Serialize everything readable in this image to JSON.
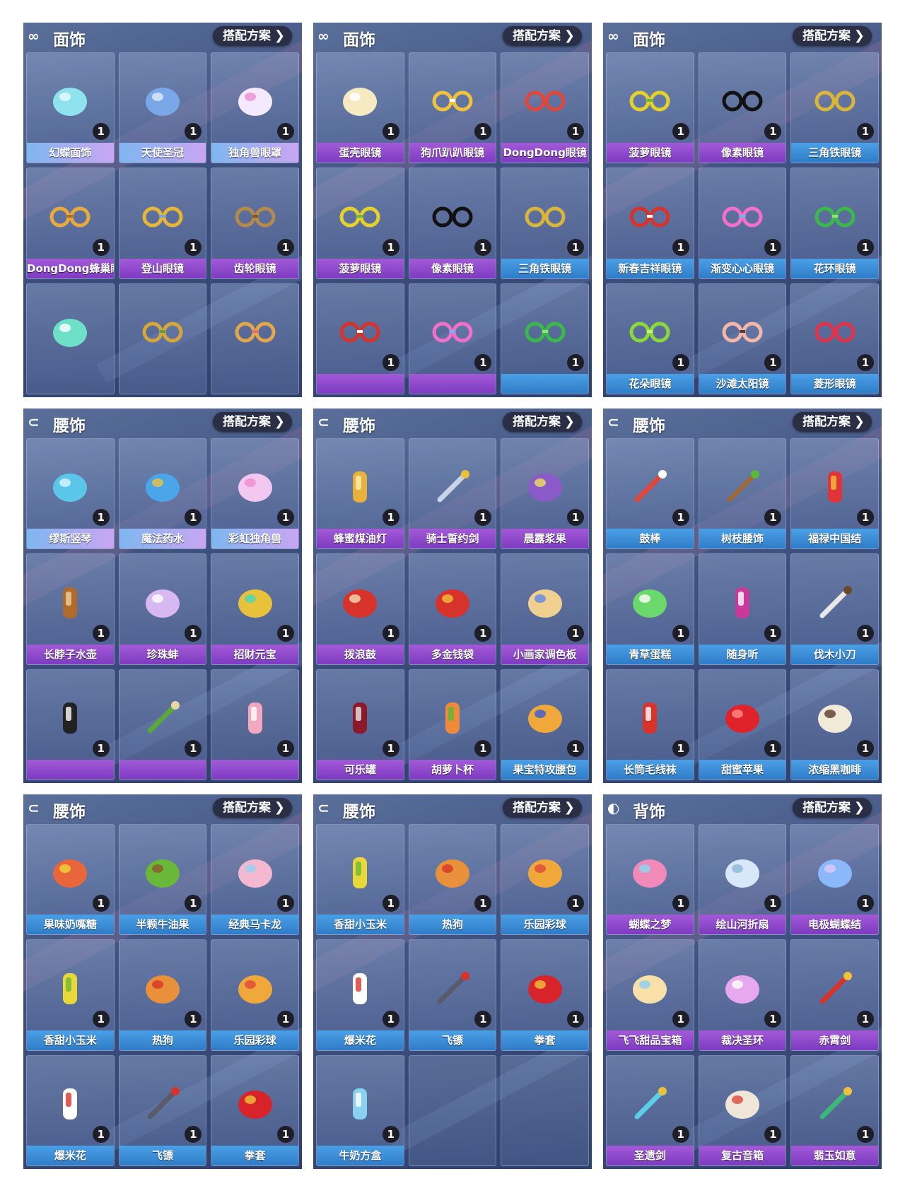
{
  "colors": {
    "purple_label": "#8a45cc",
    "blue_label": "#3a8ad8",
    "pastel_label": "#a9b0f2",
    "badge": "#1e1e28"
  },
  "panels": [
    {
      "category": "面饰",
      "icon": "glasses-icon",
      "plan_label": "搭配方案",
      "items": [
        {
          "name": "幻蝶面饰",
          "count": "1",
          "label_style": "pastel",
          "icon": "butterfly-mask-icon"
        },
        {
          "name": "天使圣冠",
          "count": "1",
          "label_style": "pastel",
          "icon": "halo-crown-icon"
        },
        {
          "name": "独角兽眼罩",
          "count": "1",
          "label_style": "pastel",
          "icon": "unicorn-mask-icon"
        },
        {
          "name": "DongDong蜂巢眼镜",
          "count": "1",
          "label_style": "purple",
          "icon": "hexagon-glasses-icon"
        },
        {
          "name": "登山眼镜",
          "count": "1",
          "label_style": "purple",
          "icon": "goggles-icon"
        },
        {
          "name": "齿轮眼镜",
          "count": "1",
          "label_style": "purple",
          "icon": "gear-glasses-icon"
        },
        {
          "name": "",
          "count": "",
          "label_style": "none",
          "icon": "fox-mask-icon"
        },
        {
          "name": "",
          "count": "",
          "label_style": "none",
          "icon": "leaf-glasses-icon"
        },
        {
          "name": "",
          "count": "",
          "label_style": "none",
          "icon": "waffle-glasses-icon"
        }
      ]
    },
    {
      "category": "面饰",
      "icon": "glasses-icon",
      "plan_label": "搭配方案",
      "items": [
        {
          "name": "蛋壳眼镜",
          "count": "1",
          "label_style": "purple",
          "icon": "eggshell-glasses-icon"
        },
        {
          "name": "狗爪趴趴眼镜",
          "count": "1",
          "label_style": "purple",
          "icon": "paw-glasses-icon"
        },
        {
          "name": "DongDong眼镜",
          "count": "1",
          "label_style": "purple",
          "icon": "round-glasses-icon"
        },
        {
          "name": "菠萝眼镜",
          "count": "1",
          "label_style": "purple",
          "icon": "pineapple-glasses-icon"
        },
        {
          "name": "像素眼镜",
          "count": "1",
          "label_style": "purple",
          "icon": "pixel-glasses-icon"
        },
        {
          "name": "三角铁眼镜",
          "count": "1",
          "label_style": "blue",
          "icon": "triangle-glasses-icon"
        },
        {
          "name": "",
          "count": "1",
          "label_style": "purple",
          "icon": "red-white-glasses-icon"
        },
        {
          "name": "",
          "count": "1",
          "label_style": "purple",
          "icon": "heart-glasses-icon"
        },
        {
          "name": "",
          "count": "1",
          "label_style": "blue",
          "icon": "flower-ring-glasses-icon"
        }
      ]
    },
    {
      "category": "面饰",
      "icon": "glasses-icon",
      "plan_label": "搭配方案",
      "items": [
        {
          "name": "菠萝眼镜",
          "count": "1",
          "label_style": "purple",
          "icon": "pineapple-glasses-icon"
        },
        {
          "name": "像素眼镜",
          "count": "1",
          "label_style": "purple",
          "icon": "pixel-glasses-icon"
        },
        {
          "name": "三角铁眼镜",
          "count": "1",
          "label_style": "blue",
          "icon": "triangle-glasses-icon"
        },
        {
          "name": "新春吉祥眼镜",
          "count": "1",
          "label_style": "blue",
          "icon": "red-white-glasses-icon"
        },
        {
          "name": "渐变心心眼镜",
          "count": "1",
          "label_style": "blue",
          "icon": "heart-glasses-icon"
        },
        {
          "name": "花环眼镜",
          "count": "1",
          "label_style": "blue",
          "icon": "flower-ring-glasses-icon"
        },
        {
          "name": "花朵眼镜",
          "count": "1",
          "label_style": "blue",
          "icon": "flower-glasses-icon"
        },
        {
          "name": "沙滩太阳镜",
          "count": "1",
          "label_style": "blue",
          "icon": "sunglasses-icon"
        },
        {
          "name": "菱形眼镜",
          "count": "1",
          "label_style": "blue",
          "icon": "diamond-glasses-icon"
        }
      ]
    },
    {
      "category": "腰饰",
      "icon": "belt-icon",
      "plan_label": "搭配方案",
      "items": [
        {
          "name": "缪斯竖琴",
          "count": "1",
          "label_style": "pastel",
          "icon": "harp-icon"
        },
        {
          "name": "魔法药水",
          "count": "1",
          "label_style": "pastel",
          "icon": "potion-icon"
        },
        {
          "name": "彩虹独角兽",
          "count": "1",
          "label_style": "pastel",
          "icon": "rainbow-unicorn-icon"
        },
        {
          "name": "长脖子水壶",
          "count": "1",
          "label_style": "purple",
          "icon": "flask-icon"
        },
        {
          "name": "珍珠蚌",
          "count": "1",
          "label_style": "purple",
          "icon": "pearl-clam-icon"
        },
        {
          "name": "招财元宝",
          "count": "1",
          "label_style": "purple",
          "icon": "gold-ingot-icon"
        },
        {
          "name": "",
          "count": "1",
          "label_style": "purple",
          "icon": "penguin-icon"
        },
        {
          "name": "",
          "count": "1",
          "label_style": "purple",
          "icon": "scroll-map-icon"
        },
        {
          "name": "",
          "count": "1",
          "label_style": "purple",
          "icon": "milk-tea-icon"
        }
      ]
    },
    {
      "category": "腰饰",
      "icon": "belt-icon",
      "plan_label": "搭配方案",
      "items": [
        {
          "name": "蜂蜜煤油灯",
          "count": "1",
          "label_style": "purple",
          "icon": "honey-lamp-icon"
        },
        {
          "name": "骑士誓约剑",
          "count": "1",
          "label_style": "purple",
          "icon": "knight-sword-icon"
        },
        {
          "name": "晨露浆果",
          "count": "1",
          "label_style": "purple",
          "icon": "berries-icon"
        },
        {
          "name": "拨浪鼓",
          "count": "1",
          "label_style": "purple",
          "icon": "rattle-drum-icon"
        },
        {
          "name": "多金钱袋",
          "count": "1",
          "label_style": "purple",
          "icon": "money-bag-icon"
        },
        {
          "name": "小画家调色板",
          "count": "1",
          "label_style": "purple",
          "icon": "palette-icon"
        },
        {
          "name": "可乐罐",
          "count": "1",
          "label_style": "purple",
          "icon": "cola-bottle-icon"
        },
        {
          "name": "胡萝卜杯",
          "count": "1",
          "label_style": "purple",
          "icon": "carrot-cup-icon"
        },
        {
          "name": "果宝特攻腰包",
          "count": "1",
          "label_style": "blue",
          "icon": "fruit-pouch-icon"
        }
      ]
    },
    {
      "category": "腰饰",
      "icon": "belt-icon",
      "plan_label": "搭配方案",
      "items": [
        {
          "name": "鼓棒",
          "count": "1",
          "label_style": "blue",
          "icon": "drumstick-icon"
        },
        {
          "name": "树枝腰饰",
          "count": "1",
          "label_style": "blue",
          "icon": "branch-icon"
        },
        {
          "name": "福禄中国结",
          "count": "1",
          "label_style": "blue",
          "icon": "chinese-knot-icon"
        },
        {
          "name": "青草蛋糕",
          "count": "1",
          "label_style": "blue",
          "icon": "cake-icon"
        },
        {
          "name": "随身听",
          "count": "1",
          "label_style": "blue",
          "icon": "music-player-icon"
        },
        {
          "name": "伐木小刀",
          "count": "1",
          "label_style": "blue",
          "icon": "knife-icon"
        },
        {
          "name": "长筒毛线袜",
          "count": "1",
          "label_style": "blue",
          "icon": "stocking-icon"
        },
        {
          "name": "甜蜜苹果",
          "count": "1",
          "label_style": "blue",
          "icon": "apple-icon"
        },
        {
          "name": "浓缩黑咖啡",
          "count": "1",
          "label_style": "blue",
          "icon": "coffee-icon"
        }
      ]
    },
    {
      "category": "腰饰",
      "icon": "belt-icon",
      "plan_label": "搭配方案",
      "items": [
        {
          "name": "果味奶嘴糖",
          "count": "1",
          "label_style": "blue",
          "icon": "pacifier-candy-icon"
        },
        {
          "name": "半颗牛油果",
          "count": "1",
          "label_style": "blue",
          "icon": "avocado-icon"
        },
        {
          "name": "经典马卡龙",
          "count": "1",
          "label_style": "blue",
          "icon": "macaron-icon"
        },
        {
          "name": "香甜小玉米",
          "count": "1",
          "label_style": "blue",
          "icon": "corn-icon"
        },
        {
          "name": "热狗",
          "count": "1",
          "label_style": "blue",
          "icon": "hotdog-icon"
        },
        {
          "name": "乐园彩球",
          "count": "1",
          "label_style": "blue",
          "icon": "beach-ball-icon"
        },
        {
          "name": "爆米花",
          "count": "1",
          "label_style": "blue",
          "icon": "popcorn-icon"
        },
        {
          "name": "飞镖",
          "count": "1",
          "label_style": "blue",
          "icon": "kunai-icon"
        },
        {
          "name": "拳套",
          "count": "1",
          "label_style": "blue",
          "icon": "boxing-glove-icon"
        }
      ]
    },
    {
      "category": "腰饰",
      "icon": "belt-icon",
      "plan_label": "搭配方案",
      "items": [
        {
          "name": "香甜小玉米",
          "count": "1",
          "label_style": "blue",
          "icon": "corn-icon"
        },
        {
          "name": "热狗",
          "count": "1",
          "label_style": "blue",
          "icon": "hotdog-icon"
        },
        {
          "name": "乐园彩球",
          "count": "1",
          "label_style": "blue",
          "icon": "beach-ball-icon"
        },
        {
          "name": "爆米花",
          "count": "1",
          "label_style": "blue",
          "icon": "popcorn-icon"
        },
        {
          "name": "飞镖",
          "count": "1",
          "label_style": "blue",
          "icon": "kunai-icon"
        },
        {
          "name": "拳套",
          "count": "1",
          "label_style": "blue",
          "icon": "boxing-glove-icon"
        },
        {
          "name": "牛奶方盒",
          "count": "1",
          "label_style": "blue",
          "icon": "milk-carton-icon"
        },
        {
          "name": "",
          "count": "",
          "label_style": "none",
          "icon": ""
        },
        {
          "name": "",
          "count": "",
          "label_style": "none",
          "icon": ""
        }
      ]
    },
    {
      "category": "背饰",
      "icon": "backpack-icon",
      "plan_label": "搭配方案",
      "items": [
        {
          "name": "蝴蝶之梦",
          "count": "1",
          "label_style": "purple",
          "icon": "butterfly-wings-icon"
        },
        {
          "name": "绘山河折扇",
          "count": "1",
          "label_style": "purple",
          "icon": "folding-fan-icon"
        },
        {
          "name": "电极蝴蝶结",
          "count": "1",
          "label_style": "purple",
          "icon": "bow-icon"
        },
        {
          "name": "飞飞甜品宝箱",
          "count": "1",
          "label_style": "purple",
          "icon": "dessert-chest-icon"
        },
        {
          "name": "裁决圣环",
          "count": "1",
          "label_style": "purple",
          "icon": "holy-ring-icon"
        },
        {
          "name": "赤霄剑",
          "count": "1",
          "label_style": "purple",
          "icon": "red-sword-icon"
        },
        {
          "name": "圣遗剑",
          "count": "1",
          "label_style": "purple",
          "icon": "relic-sword-icon"
        },
        {
          "name": "复古音箱",
          "count": "1",
          "label_style": "purple",
          "icon": "radio-icon"
        },
        {
          "name": "翡玉如意",
          "count": "1",
          "label_style": "purple",
          "icon": "jade-scepter-icon"
        }
      ]
    }
  ]
}
